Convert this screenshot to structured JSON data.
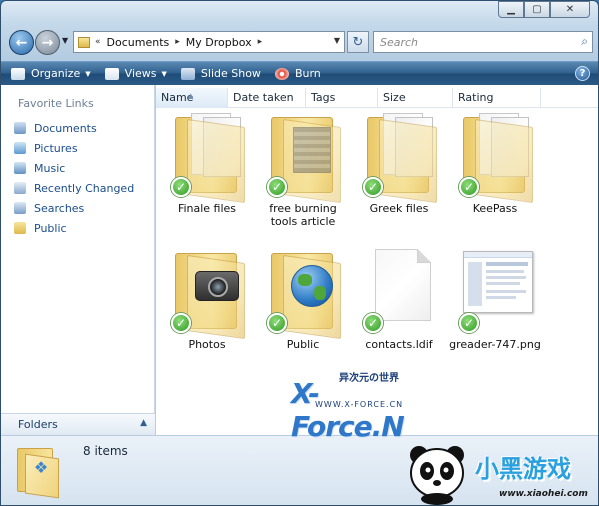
{
  "window": {
    "controls": [
      "minimize",
      "maximize",
      "close"
    ]
  },
  "address": {
    "path": [
      "Documents",
      "My Dropbox"
    ],
    "overflow": "«",
    "separator": "▸"
  },
  "search": {
    "placeholder": "Search"
  },
  "toolbar": {
    "organize": "Organize",
    "views": "Views",
    "slideshow": "Slide Show",
    "burn": "Burn"
  },
  "nav": {
    "header": "Favorite Links",
    "links": [
      "Documents",
      "Pictures",
      "Music",
      "Recently Changed",
      "Searches",
      "Public"
    ],
    "folders": "Folders"
  },
  "columns": [
    "Name",
    "Date taken",
    "Tags",
    "Size",
    "Rating"
  ],
  "items": [
    {
      "name": "Finale files",
      "type": "folder",
      "synced": true
    },
    {
      "name": "free burning tools article",
      "type": "folder-image",
      "synced": true
    },
    {
      "name": "Greek files",
      "type": "folder",
      "synced": true
    },
    {
      "name": "KeePass",
      "type": "folder",
      "synced": true
    },
    {
      "name": "Photos",
      "type": "folder-camera",
      "synced": true
    },
    {
      "name": "Public",
      "type": "folder-globe",
      "synced": true
    },
    {
      "name": "contacts.ldif",
      "type": "file",
      "synced": true
    },
    {
      "name": "greader-747.png",
      "type": "image",
      "synced": true
    }
  ],
  "details": {
    "count": "8 items"
  },
  "watermark": {
    "cn": "异次元の世界",
    "brand": "X-Force.N",
    "url": "WWW.X-FORCE.CN"
  },
  "logo": {
    "text": "小黑游戏",
    "url": "www.xiaohei.com"
  },
  "colors": {
    "toolbar": "#2e5f8d",
    "link": "#1a4d8c",
    "check": "#2f9b25",
    "folder": "#f2d985"
  }
}
